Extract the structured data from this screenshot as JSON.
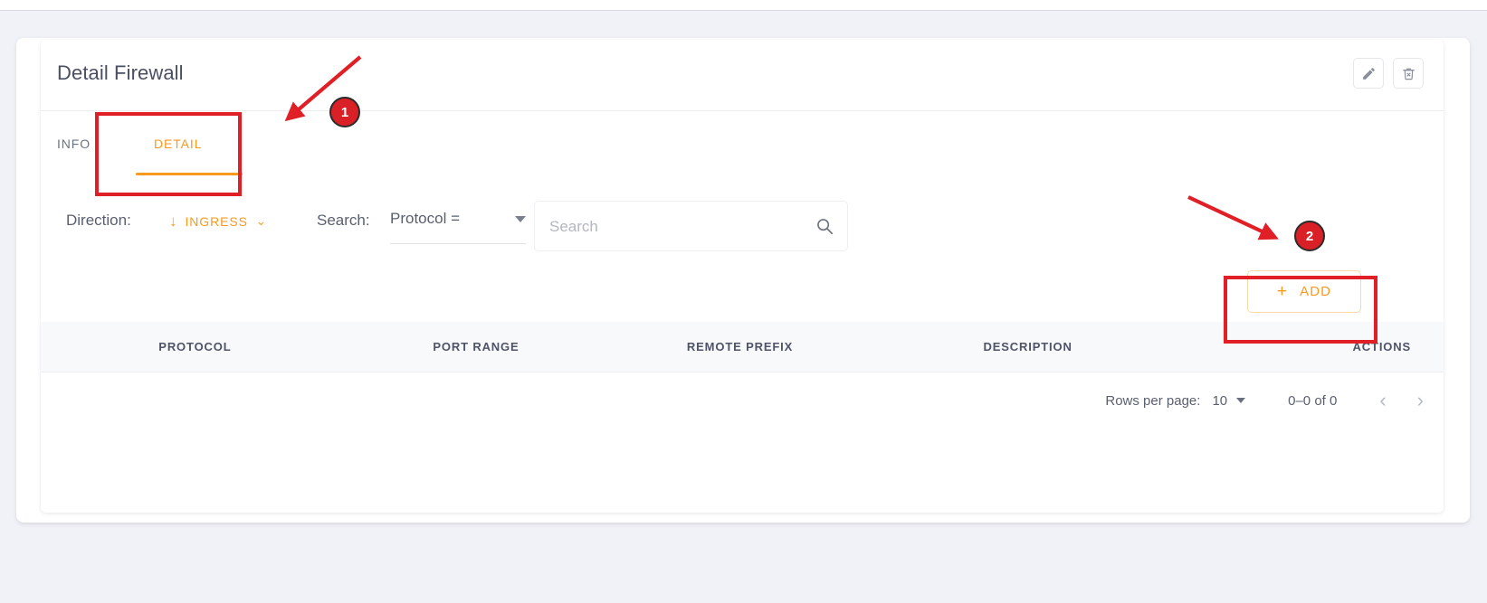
{
  "header": {
    "title": "Detail Firewall",
    "actions": [
      {
        "name": "edit-button",
        "icon": "pencil-icon",
        "label": ""
      },
      {
        "name": "delete-button",
        "icon": "trash-x-icon",
        "label": ""
      }
    ]
  },
  "tabs": [
    {
      "label": "INFO",
      "active": false
    },
    {
      "label": "DETAIL",
      "active": true
    }
  ],
  "toolbar": {
    "direction_label": "Direction:",
    "direction_value": "INGRESS",
    "direction_arrow_glyph": "↓",
    "direction_chevron_glyph": "⌄",
    "search_label": "Search:",
    "search_field_value": "Protocol =",
    "search_placeholder": "Search",
    "search_value": "",
    "search_icon": "magnifier-icon",
    "add_label": "ADD",
    "add_plus_glyph": "+"
  },
  "table": {
    "columns": [
      "PROTOCOL",
      "PORT RANGE",
      "REMOTE PREFIX",
      "DESCRIPTION",
      "ACTIONS"
    ],
    "rows": []
  },
  "pagination": {
    "rows_per_page_label": "Rows per page:",
    "rows_per_page_value": "10",
    "range_label": "0–0 of 0",
    "prev_glyph": "‹",
    "next_glyph": "›"
  },
  "annotations": {
    "badge_1": "1",
    "badge_2": "2"
  },
  "colors": {
    "accent": "#f79a1e",
    "annotation_red": "#d92027",
    "page_bg": "#f1f2f7",
    "text": "#5a5f70"
  }
}
